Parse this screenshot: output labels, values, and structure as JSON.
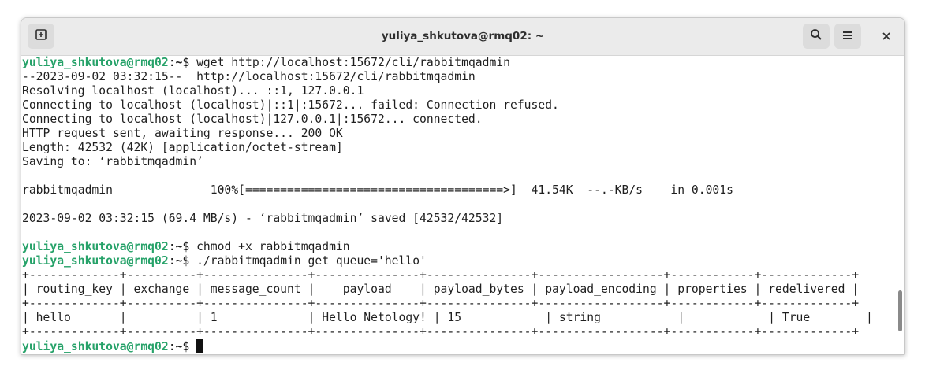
{
  "window": {
    "title": "yuliya_shkutova@rmq02: ~"
  },
  "terminal": {
    "prompt_user": "yuliya_shkutova@rmq02",
    "prompt_sep": ":",
    "prompt_path": "~",
    "prompt_sym": "$",
    "cmd1": " wget http://localhost:15672/cli/rabbitmqadmin",
    "out1": [
      "--2023-09-02 03:32:15--  http://localhost:15672/cli/rabbitmqadmin",
      "Resolving localhost (localhost)... ::1, 127.0.0.1",
      "Connecting to localhost (localhost)|::1|:15672... failed: Connection refused.",
      "Connecting to localhost (localhost)|127.0.0.1|:15672... connected.",
      "HTTP request sent, awaiting response... 200 OK",
      "Length: 42532 (42K) [application/octet-stream]",
      "Saving to: ‘rabbitmqadmin’",
      "",
      "rabbitmqadmin              100%[=====================================>]  41.54K  --.-KB/s    in 0.001s",
      "",
      "2023-09-02 03:32:15 (69.4 MB/s) - ‘rabbitmqadmin’ saved [42532/42532]",
      ""
    ],
    "cmd2": " chmod +x rabbitmqadmin",
    "cmd3": " ./rabbitmqadmin get queue='hello'",
    "out3": [
      "+-------------+----------+---------------+---------------+---------------+------------------+------------+-------------+",
      "| routing_key | exchange | message_count |    payload    | payload_bytes | payload_encoding | properties | redelivered |",
      "+-------------+----------+---------------+---------------+---------------+------------------+------------+-------------+",
      "| hello       |          | 1             | Hello Netology! | 15            | string           |            | True        |",
      "+-------------+----------+---------------+---------------+---------------+------------------+------------+-------------+"
    ],
    "cmd4": " "
  },
  "icons": {
    "new_tab": "new-tab-icon",
    "search": "search-icon",
    "menu": "hamburger-menu-icon",
    "close": "close-icon"
  },
  "colors": {
    "prompt_user": "#26a269",
    "titlebar_bg": "#ebebeb",
    "button_bg": "#dcdcdc"
  }
}
